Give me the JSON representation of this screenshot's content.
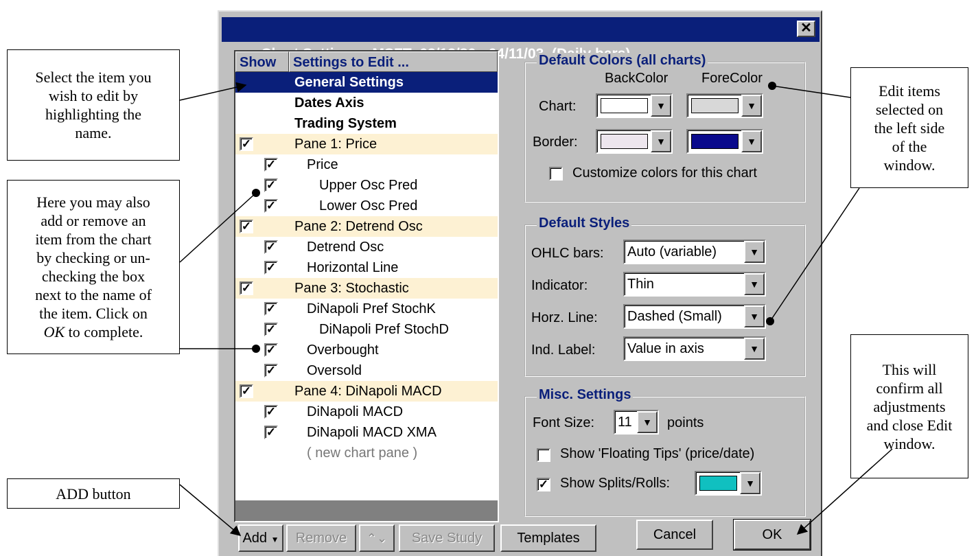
{
  "window": {
    "title": "Chart Settings:  MSFT  03/13/86 - 04/11/03  (Daily bars)",
    "close_glyph": "✕"
  },
  "list": {
    "header_show": "Show",
    "header_settings": "Settings to Edit ...",
    "rows": [
      {
        "label": "General Settings",
        "checked": false,
        "kind": "section",
        "indent": 0,
        "selected": true
      },
      {
        "label": "Dates Axis",
        "checked": false,
        "kind": "section",
        "indent": 0
      },
      {
        "label": "Trading System",
        "checked": false,
        "kind": "section",
        "indent": 0
      },
      {
        "label": "Pane 1:  Price",
        "checked": true,
        "kind": "pane",
        "indent": 0
      },
      {
        "label": "Price",
        "checked": true,
        "kind": "item",
        "indent": 1
      },
      {
        "label": "Upper Osc Pred",
        "checked": true,
        "kind": "item",
        "indent": 2
      },
      {
        "label": "Lower Osc Pred",
        "checked": true,
        "kind": "item",
        "indent": 2
      },
      {
        "label": "Pane 2:  Detrend Osc",
        "checked": true,
        "kind": "pane",
        "indent": 0
      },
      {
        "label": "Detrend Osc",
        "checked": true,
        "kind": "item",
        "indent": 1
      },
      {
        "label": "Horizontal Line",
        "checked": true,
        "kind": "item",
        "indent": 1
      },
      {
        "label": "Pane 3:  Stochastic",
        "checked": true,
        "kind": "pane",
        "indent": 0
      },
      {
        "label": "DiNapoli Pref StochK",
        "checked": true,
        "kind": "item",
        "indent": 1
      },
      {
        "label": "DiNapoli Pref StochD",
        "checked": true,
        "kind": "item",
        "indent": 2
      },
      {
        "label": "Overbought",
        "checked": true,
        "kind": "item",
        "indent": 1
      },
      {
        "label": "Oversold",
        "checked": true,
        "kind": "item",
        "indent": 1
      },
      {
        "label": "Pane 4:  DiNapoli MACD",
        "checked": true,
        "kind": "pane",
        "indent": 0
      },
      {
        "label": "DiNapoli MACD",
        "checked": true,
        "kind": "item",
        "indent": 1
      },
      {
        "label": "DiNapoli MACD XMA",
        "checked": true,
        "kind": "item",
        "indent": 1
      },
      {
        "label": "( new chart pane )",
        "checked": false,
        "kind": "new",
        "indent": 1
      }
    ]
  },
  "colors": {
    "group_title": "Default Colors (all charts)",
    "back_header": "BackColor",
    "fore_header": "ForeColor",
    "chart_label": "Chart:",
    "border_label": "Border:",
    "chart_back": "#ffffff",
    "chart_fore": "#d8d8d8",
    "border_back": "#ede6ee",
    "border_fore": "#0a0a8c",
    "customize_label": "Customize colors for this chart",
    "customize_checked": false
  },
  "styles": {
    "group_title": "Default Styles",
    "ohlc_label": "OHLC bars:",
    "ohlc_value": "Auto (variable)",
    "indicator_label": "Indicator:",
    "indicator_value": "Thin",
    "horz_label": "Horz. Line:",
    "horz_value": "Dashed (Small)",
    "indlabel_label": "Ind. Label:",
    "indlabel_value": "Value in axis"
  },
  "misc": {
    "group_title": "Misc. Settings",
    "font_label": "Font Size:",
    "font_value": "11",
    "points_label": "points",
    "floating_label": "Show 'Floating Tips' (price/date)",
    "floating_checked": false,
    "splits_label": "Show Splits/Rolls:",
    "splits_checked": true,
    "splits_color": "#10c0c0"
  },
  "buttons": {
    "add": "Add",
    "remove": "Remove",
    "updown": "⌃⌄",
    "save_study": "Save Study",
    "templates": "Templates",
    "cancel": "Cancel",
    "ok": "OK"
  },
  "callouts": {
    "select_item": [
      "Select the item you",
      "wish to edit by",
      "highlighting the",
      "name."
    ],
    "add_remove": [
      "Here you may also",
      "add or remove an",
      "item from the chart",
      "by checking or un-",
      "checking the box",
      "next to the name of",
      "the item. Click on",
      "OK to complete."
    ],
    "add_button": [
      "ADD button"
    ],
    "edit_items": [
      "Edit items",
      "selected on",
      "the left side",
      "of the",
      "window."
    ],
    "confirm": [
      "This will",
      "confirm all",
      "adjustments",
      "and close Edit",
      "window."
    ]
  },
  "accent_colors": {
    "title_bar": "#0a1f7a",
    "pane_row": "#fdf1d3",
    "dialog_face": "#c0c0c0"
  }
}
